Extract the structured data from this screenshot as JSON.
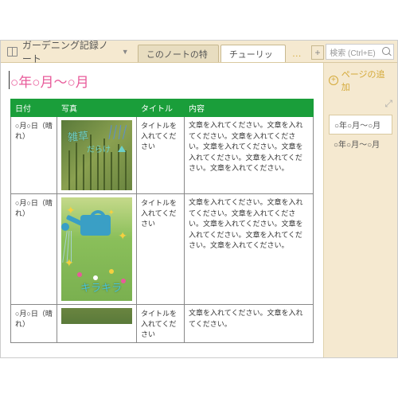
{
  "notebook": {
    "title": "ガーデニング記録ノート"
  },
  "tabs": [
    {
      "label": "このノートの特長",
      "active": false
    },
    {
      "label": "チューリップ",
      "active": true
    }
  ],
  "search": {
    "placeholder": "検索 (Ctrl+E)"
  },
  "sidebar": {
    "add_page": "ページの追加",
    "pages": [
      {
        "label": "○年○月～○月",
        "selected": true
      },
      {
        "label": "○年○月～○月",
        "selected": false
      }
    ]
  },
  "page": {
    "title": "○年○月～○月"
  },
  "table": {
    "headers": {
      "date": "日付",
      "photo": "写真",
      "title": "タイトル",
      "content": "内容"
    },
    "rows": [
      {
        "date": "○月○日（晴れ）",
        "photo_annotations": {
          "line1": "雑草",
          "line2": "だらけ"
        },
        "title": "タイトルを入れてください",
        "content": "文章を入れてください。文章を入れてください。文章を入れてください。文章を入れてください。文章を入れてください。文章を入れてください。文章を入れてください。"
      },
      {
        "date": "○月○日（晴れ）",
        "photo_annotations": {
          "line1": "キラキラ"
        },
        "title": "タイトルを入れてください",
        "content": "文章を入れてください。文章を入れてください。文章を入れてください。文章を入れてください。文章を入れてください。文章を入れてください。文章を入れてください。"
      },
      {
        "date": "○月○日（晴れ）",
        "title": "タイトルを入れてください",
        "content": "文章を入れてください。文章を入れてください。"
      }
    ]
  }
}
